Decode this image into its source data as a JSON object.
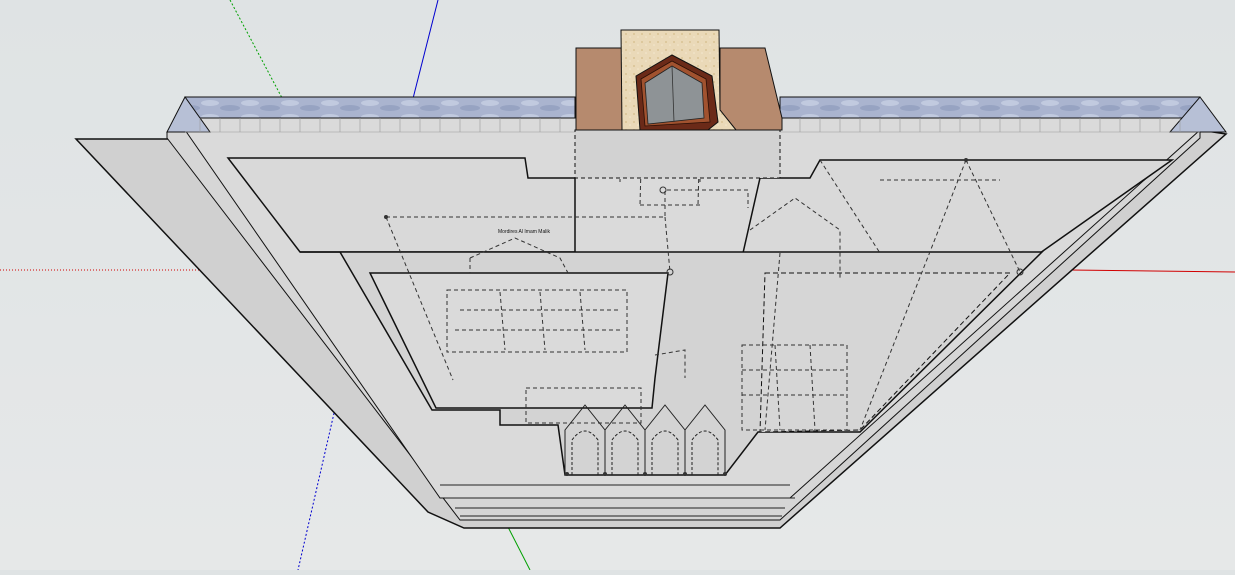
{
  "app": {
    "name": "3D modeling viewport"
  },
  "model": {
    "label_text": "Mordires Al Imam Malik",
    "colors": {
      "sky": "#e2e5e6",
      "surface": "#d4d4d4",
      "surface_light": "#dcdcdc",
      "water": "#a9b3cd",
      "brick": "#b5866a",
      "sand": "#ead9b8",
      "door_frame": "#6b2a18",
      "door_glass": "#8e9396",
      "edge": "#111111",
      "hidden_edge": "#444444",
      "axis_red": "#d10000",
      "axis_green": "#00a000",
      "axis_blue": "#0000d0"
    }
  }
}
